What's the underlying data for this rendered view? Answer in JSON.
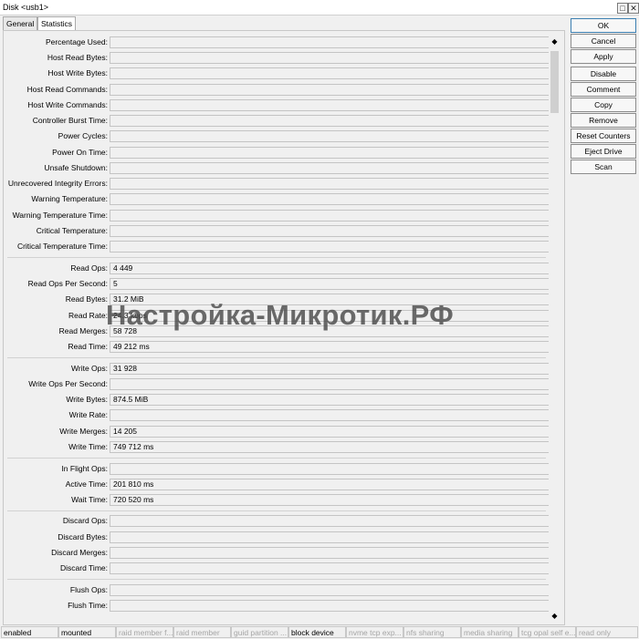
{
  "window": {
    "title": "Disk <usb1>",
    "minimize_label": "□",
    "close_label": "✕"
  },
  "tabs": [
    {
      "label": "General",
      "active": false
    },
    {
      "label": "Statistics",
      "active": true
    }
  ],
  "fields": {
    "percentage_used": {
      "label": "Percentage Used:",
      "value": ""
    },
    "host_read_bytes": {
      "label": "Host Read Bytes:",
      "value": ""
    },
    "host_write_bytes": {
      "label": "Host Write Bytes:",
      "value": ""
    },
    "host_read_commands": {
      "label": "Host Read Commands:",
      "value": ""
    },
    "host_write_commands": {
      "label": "Host Write Commands:",
      "value": ""
    },
    "controller_burst_time": {
      "label": "Controller Burst Time:",
      "value": ""
    },
    "power_cycles": {
      "label": "Power Cycles:",
      "value": ""
    },
    "power_on_time": {
      "label": "Power On Time:",
      "value": ""
    },
    "unsafe_shutdown": {
      "label": "Unsafe Shutdown:",
      "value": ""
    },
    "unrecovered_integrity_errors": {
      "label": "Unrecovered Integrity Errors:",
      "value": ""
    },
    "warning_temperature": {
      "label": "Warning Temperature:",
      "value": ""
    },
    "warning_temperature_time": {
      "label": "Warning Temperature Time:",
      "value": ""
    },
    "critical_temperature": {
      "label": "Critical Temperature:",
      "value": ""
    },
    "critical_temperature_time": {
      "label": "Critical Temperature Time:",
      "value": ""
    },
    "read_ops": {
      "label": "Read Ops:",
      "value": "4 449"
    },
    "read_ops_per_second": {
      "label": "Read Ops Per Second:",
      "value": "5"
    },
    "read_bytes": {
      "label": "Read Bytes:",
      "value": "31.2 MiB"
    },
    "read_rate": {
      "label": "Read Rate:",
      "value": "24.3 kbps"
    },
    "read_merges": {
      "label": "Read Merges:",
      "value": "58 728"
    },
    "read_time": {
      "label": "Read Time:",
      "value": "49 212 ms"
    },
    "write_ops": {
      "label": "Write Ops:",
      "value": "31 928"
    },
    "write_ops_per_second": {
      "label": "Write Ops Per Second:",
      "value": ""
    },
    "write_bytes": {
      "label": "Write Bytes:",
      "value": "874.5 MiB"
    },
    "write_rate": {
      "label": "Write Rate:",
      "value": ""
    },
    "write_merges": {
      "label": "Write Merges:",
      "value": "14 205"
    },
    "write_time": {
      "label": "Write Time:",
      "value": "749 712 ms"
    },
    "in_flight_ops": {
      "label": "In Flight Ops:",
      "value": ""
    },
    "active_time": {
      "label": "Active Time:",
      "value": "201 810 ms"
    },
    "wait_time": {
      "label": "Wait Time:",
      "value": "720 520 ms"
    },
    "discard_ops": {
      "label": "Discard Ops:",
      "value": ""
    },
    "discard_bytes": {
      "label": "Discard Bytes:",
      "value": ""
    },
    "discard_merges": {
      "label": "Discard Merges:",
      "value": ""
    },
    "discard_time": {
      "label": "Discard Time:",
      "value": ""
    },
    "flush_ops": {
      "label": "Flush Ops:",
      "value": ""
    },
    "flush_time": {
      "label": "Flush Time:",
      "value": ""
    }
  },
  "scrollbar": {
    "up_arrow": "◆",
    "down_arrow": "◆"
  },
  "buttons": {
    "ok": "OK",
    "cancel": "Cancel",
    "apply": "Apply",
    "disable": "Disable",
    "comment": "Comment",
    "copy": "Copy",
    "remove": "Remove",
    "reset_counters": "Reset Counters",
    "eject_drive": "Eject Drive",
    "scan": "Scan"
  },
  "watermark": "Настройка-Микротик.РФ",
  "status": {
    "enabled": "enabled",
    "mounted": "mounted",
    "raid_member_failed": "raid member f...",
    "raid_member": "raid member",
    "guid_partition": "guid partition ...",
    "block_device": "block device",
    "nvme_tcp_export": "nvme tcp exp...",
    "nfs_sharing": "nfs sharing",
    "media_sharing": "media sharing",
    "tcg_opal_self_encryption": "tcg opal self e...",
    "read_only": "read only"
  }
}
